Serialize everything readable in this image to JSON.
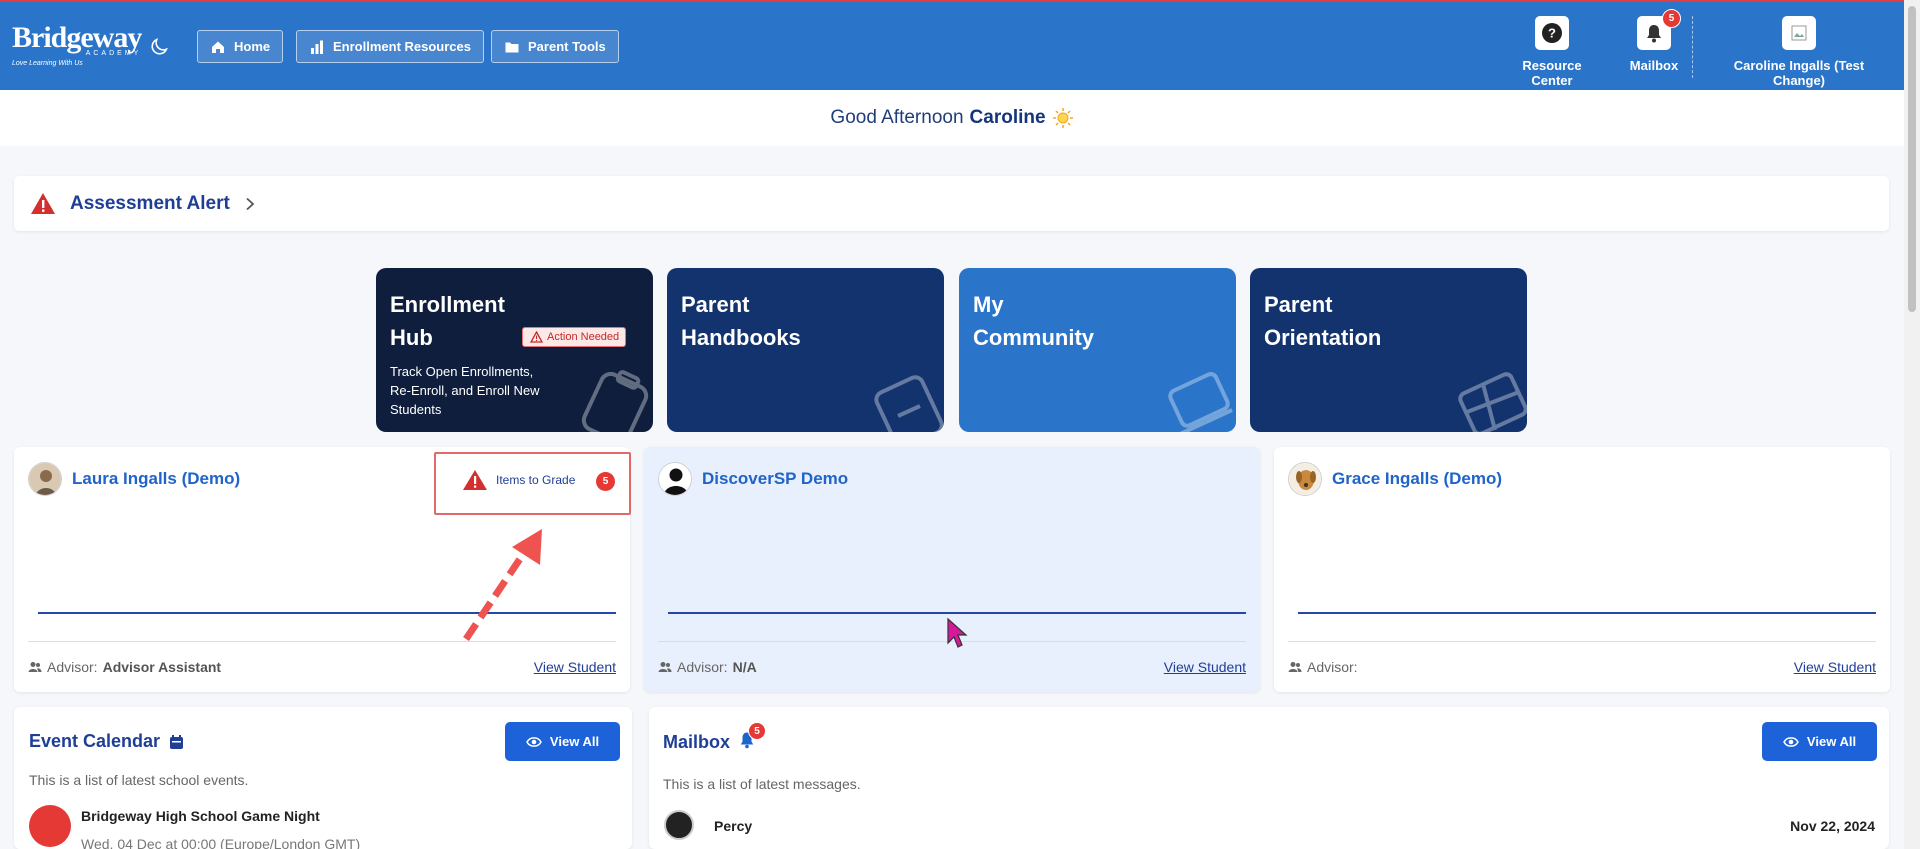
{
  "header": {
    "logo_text": "Bridgeway",
    "logo_sub": "ACADEMY",
    "logo_tag": "Love Learning With Us",
    "nav": [
      {
        "label": "Home",
        "icon": "home-icon"
      },
      {
        "label": "Enrollment Resources",
        "icon": "bar-chart-icon"
      },
      {
        "label": "Parent Tools",
        "icon": "folder-icon"
      }
    ],
    "resource_center": "Resource Center",
    "mailbox": "Mailbox",
    "mailbox_count": "5",
    "user_name": "Caroline Ingalls (Test Change)",
    "accent": "#2a74c9"
  },
  "greeting": {
    "prefix": "Good Afternoon",
    "name": "Caroline",
    "emoji": "☀️"
  },
  "assessment": {
    "title": "Assessment Alert"
  },
  "tiles": [
    {
      "line1": "Enrollment",
      "line2": "Hub",
      "desc": "Track Open Enrollments, Re-Enroll, and Enroll New Students",
      "badge": "Action Needed",
      "color": "#0f1e3d"
    },
    {
      "line1": "Parent",
      "line2": "Handbooks",
      "color": "#12336e"
    },
    {
      "line1": "My",
      "line2": "Community",
      "color": "#2a74c9"
    },
    {
      "line1": "Parent",
      "line2": "Orientation",
      "color": "#12336e"
    }
  ],
  "students": [
    {
      "name": "Laura Ingalls (Demo)",
      "advisor_label": "Advisor:",
      "advisor": "Advisor Assistant",
      "view": "View Student"
    },
    {
      "name": "DiscoverSP Demo",
      "advisor_label": "Advisor:",
      "advisor": "N/A",
      "view": "View Student"
    },
    {
      "name": "Grace Ingalls (Demo)",
      "advisor_label": "Advisor:",
      "advisor": "",
      "view": "View Student"
    }
  ],
  "items_to_grade": {
    "label": "Items to Grade",
    "count": "5"
  },
  "calendar": {
    "title": "Event Calendar",
    "view_all": "View All",
    "subtitle": "This is a list of latest school events.",
    "event_title": "Bridgeway High School Game Night",
    "event_time": "Wed, 04 Dec at 00:00 (Europe/London GMT)"
  },
  "mailbox_panel": {
    "title": "Mailbox",
    "count": "5",
    "view_all": "View All",
    "subtitle": "This is a list of latest messages.",
    "sender": "Percy",
    "date": "Nov 22, 2024"
  }
}
